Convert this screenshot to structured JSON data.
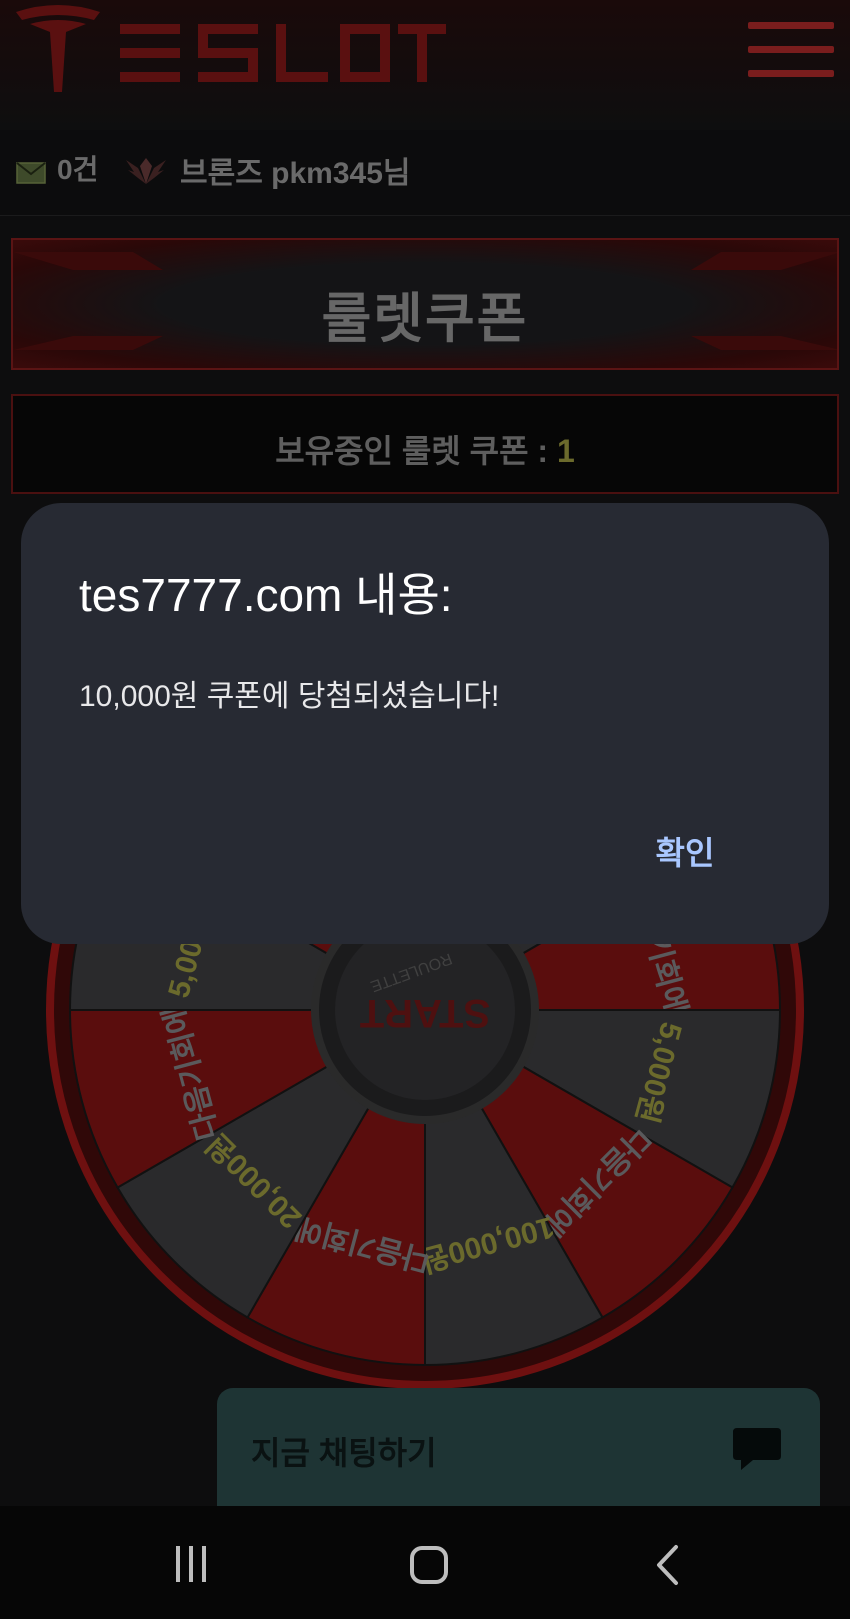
{
  "header": {
    "logo_text": "TESLOT",
    "menu_icon": "hamburger-menu-icon"
  },
  "userbar": {
    "mail_icon": "envelope-icon",
    "mail_count": "0건",
    "rank_icon": "bronze-wings-icon",
    "user_label": "브론즈 pkm345님"
  },
  "banner": {
    "title": "룰렛쿠폰"
  },
  "coupon": {
    "label": "보유중인 룰렛 쿠폰 : ",
    "count": "1"
  },
  "wheel": {
    "center_text": "START",
    "center_subtext": "ROULETTE",
    "segments": [
      "다음기회에",
      "20,000원",
      "다음기회에",
      "5,000원",
      "다음기회에",
      "100,000원"
    ],
    "colors": {
      "red": "#5a0d0d",
      "dark": "#2a2a2c",
      "gold": "#6b6a2c",
      "rim": "#6e1010"
    }
  },
  "dialog": {
    "title": "tes7777.com 내용:",
    "message": "10,000원 쿠폰에 당첨되셨습니다!",
    "ok_label": "확인"
  },
  "chat": {
    "label": "지금 채팅하기",
    "icon": "chat-bubble-icon"
  },
  "navbar": {
    "recent_icon": "recent-apps-icon",
    "home_icon": "home-icon",
    "back_icon": "back-icon"
  }
}
